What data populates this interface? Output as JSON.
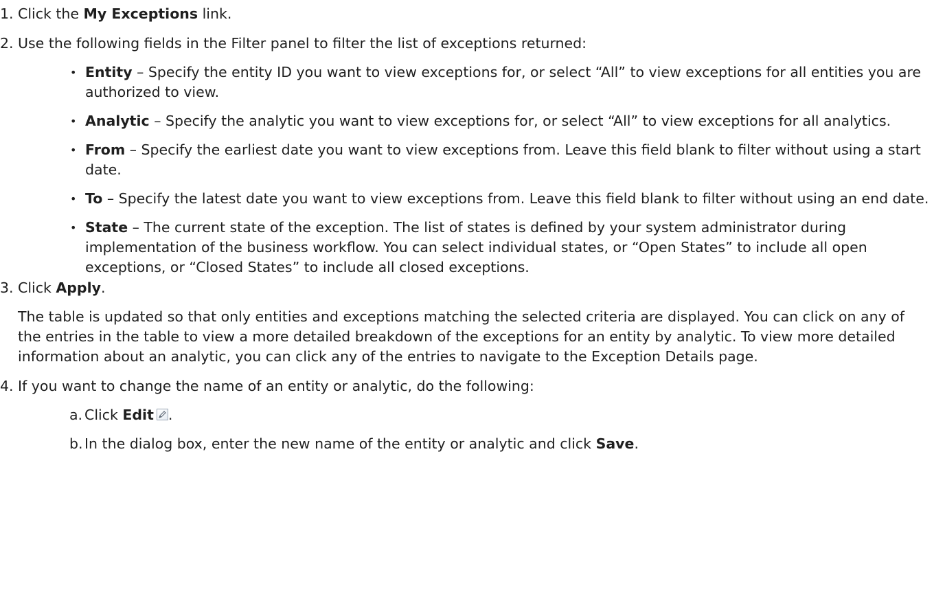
{
  "steps": [
    {
      "num": "1.",
      "pre": "Click the ",
      "bold": "My Exceptions",
      "post": " link."
    },
    {
      "num": "2.",
      "text": "Use the following fields in the Filter panel to filter the list of exceptions returned:",
      "bullets": [
        {
          "label": "Entity",
          "text": " – Specify the entity ID you want to view exceptions for, or select “All” to view exceptions for all entities you are authorized to view."
        },
        {
          "label": "Analytic",
          "text": " – Specify the analytic you want to view exceptions for, or select “All” to view exceptions for all analytics."
        },
        {
          "label": "From",
          "text": " – Specify the earliest date you want to view exceptions from. Leave this field blank to filter without using a start date."
        },
        {
          "label": "To",
          "text": " – Specify the latest date you want to view exceptions from. Leave this field blank to filter without using an end date."
        },
        {
          "label": "State",
          "text": " – The current state of the exception. The list of states is defined by your system administrator during implementation of the business workflow. You can select individual states, or “Open States” to include all open exceptions, or “Closed States” to include all closed exceptions."
        }
      ]
    },
    {
      "num": "3.",
      "pre": "Click ",
      "bold": "Apply",
      "post": ".",
      "para": "The table is updated so that only entities and exceptions matching the selected criteria are displayed. You can click on any of the entries in the table to view a more detailed breakdown of the exceptions for an entity by analytic. To view more detailed information about an analytic, you can click any of the entries to navigate to the Exception Details page."
    },
    {
      "num": "4.",
      "text": "If you want to change the name of an entity or analytic, do the following:",
      "substeps": [
        {
          "letter": "a.",
          "pre": "Click ",
          "bold": "Edit",
          "post": ".",
          "icon": "edit-icon"
        },
        {
          "letter": "b.",
          "pre": "In the dialog box, enter the new name of the entity or analytic and click ",
          "bold": "Save",
          "post": "."
        }
      ]
    }
  ]
}
